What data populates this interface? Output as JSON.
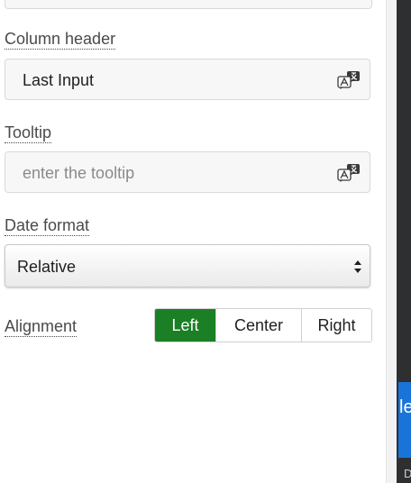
{
  "form": {
    "column_header": {
      "label": "Column header",
      "value": "Last Input"
    },
    "tooltip": {
      "label": "Tooltip",
      "placeholder": "enter the tooltip"
    },
    "date_format": {
      "label": "Date format",
      "selected": "Relative"
    },
    "alignment": {
      "label": "Alignment",
      "options": [
        "Left",
        "Center",
        "Right"
      ],
      "selected": "Left"
    }
  },
  "right_pane": {
    "blue_text": "le",
    "bottom_text": "D"
  },
  "colors": {
    "accent_green": "#1a7f25",
    "right_pane_blue": "#1a73d9",
    "right_pane_dark": "#2e2f31"
  },
  "icons": {
    "translate": "translate-icon",
    "select_chevron": "chevron-up-down-icon"
  }
}
